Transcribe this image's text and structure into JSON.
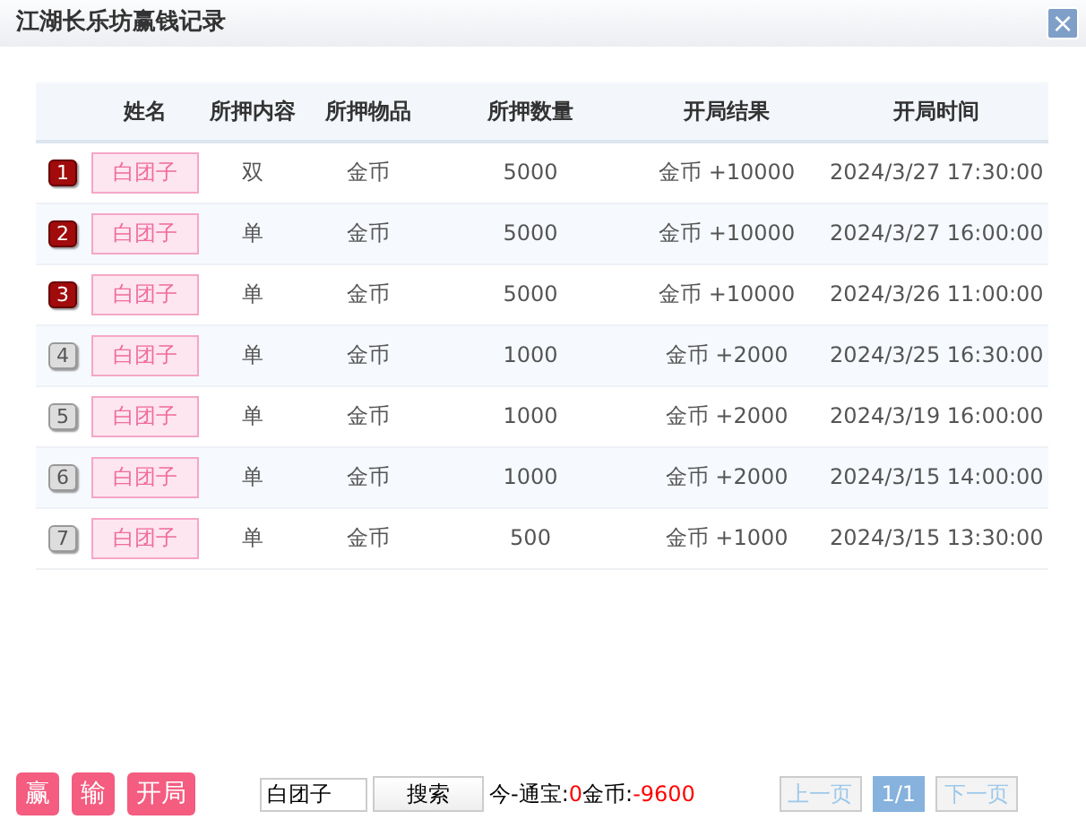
{
  "window": {
    "title": "江湖长乐坊赢钱记录",
    "close": "×"
  },
  "table": {
    "columns": [
      "",
      "姓名",
      "所押内容",
      "所押物品",
      "所押数量",
      "开局结果",
      "开局时间"
    ],
    "rows": [
      {
        "rank": "1",
        "kind": "top",
        "name": "白团子",
        "content": "双",
        "item": "金币",
        "amount": "5000",
        "result": "金币 +10000",
        "time": "2024/3/27 17:30:00"
      },
      {
        "rank": "2",
        "kind": "top",
        "name": "白团子",
        "content": "单",
        "item": "金币",
        "amount": "5000",
        "result": "金币 +10000",
        "time": "2024/3/27 16:00:00"
      },
      {
        "rank": "3",
        "kind": "top",
        "name": "白团子",
        "content": "单",
        "item": "金币",
        "amount": "5000",
        "result": "金币 +10000",
        "time": "2024/3/26 11:00:00"
      },
      {
        "rank": "4",
        "kind": "normal",
        "name": "白团子",
        "content": "单",
        "item": "金币",
        "amount": "1000",
        "result": "金币 +2000",
        "time": "2024/3/25 16:30:00"
      },
      {
        "rank": "5",
        "kind": "normal",
        "name": "白团子",
        "content": "单",
        "item": "金币",
        "amount": "1000",
        "result": "金币 +2000",
        "time": "2024/3/19 16:00:00"
      },
      {
        "rank": "6",
        "kind": "normal",
        "name": "白团子",
        "content": "单",
        "item": "金币",
        "amount": "1000",
        "result": "金币 +2000",
        "time": "2024/3/15 14:00:00"
      },
      {
        "rank": "7",
        "kind": "normal",
        "name": "白团子",
        "content": "单",
        "item": "金币",
        "amount": "500",
        "result": "金币 +1000",
        "time": "2024/3/15 13:30:00"
      }
    ]
  },
  "filters": [
    "赢",
    "输",
    "开局"
  ],
  "search": {
    "value": "白团子",
    "button": "搜索"
  },
  "summary": [
    {
      "kind": "label",
      "text": "今-通宝:"
    },
    {
      "kind": "value",
      "text": "0"
    },
    {
      "kind": "label",
      "text": "金币:"
    },
    {
      "kind": "value",
      "text": "-9600"
    }
  ],
  "pager": [
    {
      "label": "上一页",
      "selected": false,
      "disabled": true
    },
    {
      "label": "1/1",
      "selected": true,
      "disabled": false
    },
    {
      "label": "下一页",
      "selected": false,
      "disabled": true
    }
  ]
}
